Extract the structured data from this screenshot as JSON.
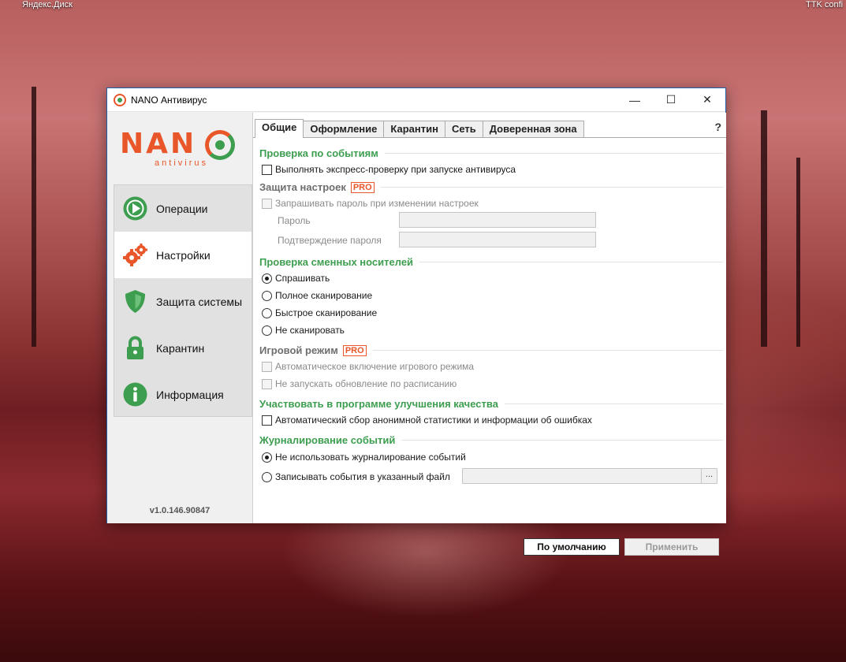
{
  "desktop": {
    "left_label": "Яндекс.Диск",
    "right_label": "TTK confi"
  },
  "window": {
    "title": "NANO Антивирус",
    "controls": {
      "minimize": "—",
      "maximize": "☐",
      "close": "✕"
    }
  },
  "sidebar": {
    "logo_text": "NAN",
    "logo_sub": "antivirus",
    "items": [
      {
        "label": "Операции",
        "icon": "play-icon"
      },
      {
        "label": "Настройки",
        "icon": "gears-icon"
      },
      {
        "label": "Защита системы",
        "icon": "shield-icon"
      },
      {
        "label": "Карантин",
        "icon": "lock-icon"
      },
      {
        "label": "Информация",
        "icon": "info-icon"
      }
    ],
    "active_index": 1,
    "version": "v1.0.146.90847"
  },
  "tabs": [
    {
      "label": "Общие",
      "active": true
    },
    {
      "label": "Оформление",
      "active": false
    },
    {
      "label": "Карантин",
      "active": false
    },
    {
      "label": "Сеть",
      "active": false
    },
    {
      "label": "Доверенная зона",
      "active": false
    }
  ],
  "help": "?",
  "pro_badge": "PRO",
  "sections": {
    "events": {
      "title": "Проверка по событиям",
      "express_check": {
        "label": "Выполнять экспресс-проверку при запуске антивируса",
        "checked": false
      }
    },
    "protection": {
      "title": "Защита настроек",
      "ask_password": {
        "label": "Запрашивать пароль при изменении настроек",
        "checked": false
      },
      "password_label": "Пароль",
      "confirm_label": "Подтверждение пароля"
    },
    "removable": {
      "title": "Проверка сменных носителей",
      "options": [
        {
          "label": "Спрашивать",
          "selected": true
        },
        {
          "label": "Полное сканирование",
          "selected": false
        },
        {
          "label": "Быстрое сканирование",
          "selected": false
        },
        {
          "label": "Не сканировать",
          "selected": false
        }
      ]
    },
    "game": {
      "title": "Игровой режим",
      "auto_game": {
        "label": "Автоматическое включение игрового режима",
        "checked": false
      },
      "no_update": {
        "label": "Не запускать обновление по расписанию",
        "checked": false
      }
    },
    "quality": {
      "title": "Участвовать в программе улучшения качества",
      "stats": {
        "label": "Автоматический сбор анонимной статистики и информации об ошибках",
        "checked": false
      }
    },
    "logging": {
      "title": "Журналирование событий",
      "options": [
        {
          "label": "Не использовать журналирование событий",
          "selected": true
        },
        {
          "label": "Записывать события в указанный файл",
          "selected": false
        }
      ],
      "browse": "..."
    }
  },
  "buttons": {
    "default": "По умолчанию",
    "apply": "Применить"
  },
  "colors": {
    "accent_green": "#3d9e4f",
    "accent_orange": "#e8562a",
    "window_border": "#1f5fa8"
  }
}
